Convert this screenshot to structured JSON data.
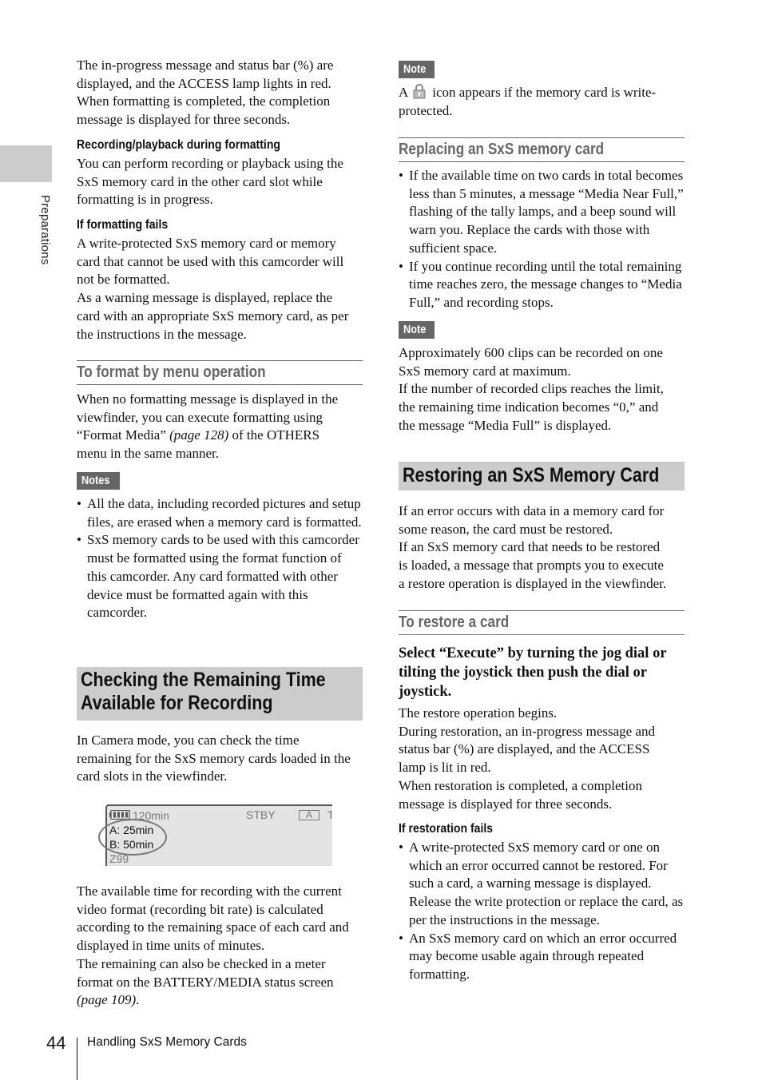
{
  "side_tab": {
    "label": "Preparations"
  },
  "left": {
    "intro": [
      "The in-progress message and status bar (%) are",
      "displayed, and the ACCESS lamp lights in red.",
      "When formatting is completed, the completion",
      "message is displayed for three seconds."
    ],
    "rec_playback": {
      "heading": "Recording/playback during formatting",
      "lines": [
        "You can perform recording or playback using the",
        "SxS memory card in the other card slot while",
        "formatting is in progress."
      ]
    },
    "format_fails": {
      "heading": "If formatting fails",
      "lines": [
        "A write-protected SxS memory card or memory",
        "card that cannot be used with this camcorder will",
        "not be formatted.",
        "As a warning message is displayed, replace the",
        "card with an appropriate SxS memory card, as per",
        "the instructions in the message."
      ]
    },
    "menu_op": {
      "heading": "To format by menu operation",
      "line1": "When no formatting message is displayed in the",
      "line2": "viewfinder, you can execute formatting using",
      "line3_pre": "“Format Media” ",
      "line3_ref": "(page 128)",
      "line3_post": " of the OTHERS",
      "line4": "menu in the same manner."
    },
    "notes": {
      "badge": "Notes",
      "items": [
        "All the data, including recorded pictures and setup files, are erased when a memory card is formatted.",
        "SxS memory cards to be used with this camcorder must be formatted using the format function of this camcorder. Any card formatted with other device must be formatted again with this camcorder."
      ]
    },
    "checking": {
      "heading_line1": "Checking the Remaining Time",
      "heading_line2": "Available for Recording",
      "lines": [
        "In Camera mode, you can check the time",
        "remaining for the SxS memory cards loaded in the",
        "card slots in the viewfinder."
      ]
    },
    "viewfinder": {
      "battery_time": "120min",
      "status": "STBY",
      "slot": "A",
      "trailing": "T",
      "card_a": "A:  25min",
      "card_b": "B:  50min",
      "bottom": "Z99"
    },
    "available": {
      "lines": [
        "The available time for recording with the current",
        "video format (recording bit rate) is calculated",
        "according to the remaining space of each card and",
        "displayed in time units of minutes.",
        "The remaining can also be checked in a meter",
        "format on the BATTERY/MEDIA status screen"
      ],
      "ref": "(page 109)",
      "ref_end": "."
    }
  },
  "right": {
    "note1": {
      "badge": "Note",
      "pre": "A",
      "icon": "lock-icon",
      "post": "icon appears if the memory card is write-",
      "line2": "protected."
    },
    "replacing": {
      "heading": "Replacing an SxS memory card",
      "items": [
        "If the available time on two cards in total becomes less than 5 minutes, a message “Media Near Full,” flashing of the tally lamps, and a beep sound will warn you. Replace the cards with those with sufficient space.",
        "If you continue recording until the total remaining time reaches zero, the message changes to “Media Full,” and recording stops."
      ]
    },
    "note2": {
      "badge": "Note",
      "lines": [
        "Approximately 600 clips can be recorded on one",
        "SxS memory card at maximum.",
        "If the number of recorded clips reaches the limit,",
        "the remaining time indication becomes “0,” and",
        "the message “Media Full” is displayed."
      ]
    },
    "restoring": {
      "heading": "Restoring an SxS Memory Card",
      "lines": [
        "If an error occurs with data in a memory card for",
        "some reason, the card must be restored.",
        "If an SxS memory card that needs to be restored",
        "is loaded, a message that prompts you to execute",
        "a restore operation is displayed in the viewfinder."
      ]
    },
    "restore_card": {
      "heading": "To restore a card",
      "step": [
        "Select “Execute” by turning the jog dial or",
        "tilting the joystick then push the dial or",
        "joystick."
      ],
      "lines": [
        "The restore operation begins.",
        "During restoration, an in-progress message and",
        "status bar (%) are displayed, and the ACCESS",
        "lamp is lit in red.",
        "When restoration is completed, a completion",
        "message is displayed for three seconds."
      ]
    },
    "restore_fails": {
      "heading": "If restoration fails",
      "items": [
        "A write-protected SxS memory card or one on which an error occurred cannot be restored. For such a card, a warning message is displayed. Release the write protection or replace the card, as per the instructions in the message.",
        "An SxS memory card on which an error occurred may become usable again through repeated formatting."
      ]
    }
  },
  "footer": {
    "page_number": "44",
    "section_title": "Handling SxS Memory Cards"
  }
}
